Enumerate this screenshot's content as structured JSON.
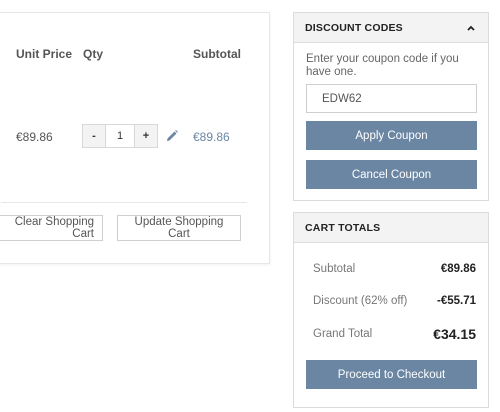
{
  "cart": {
    "headers": {
      "unit_price": "Unit Price",
      "qty": "Qty",
      "subtotal": "Subtotal"
    },
    "item": {
      "unit_price": "€89.86",
      "qty": "1",
      "subtotal": "€89.86"
    },
    "qty_minus": "-",
    "qty_plus": "+",
    "clear_button": "Clear Shopping Cart",
    "update_button": "Update Shopping Cart"
  },
  "discount": {
    "title": "DISCOUNT CODES",
    "description": "Enter your coupon code if you have one.",
    "coupon_value": "EDW62",
    "apply_button": "Apply Coupon",
    "cancel_button": "Cancel Coupon"
  },
  "totals": {
    "title": "CART TOTALS",
    "rows": [
      {
        "label": "Subtotal",
        "value": "€89.86"
      },
      {
        "label": "Discount (62% off)",
        "value": "-€55.71"
      },
      {
        "label": "Grand Total",
        "value": "€34.15"
      }
    ],
    "checkout_button": "Proceed to Checkout"
  },
  "colors": {
    "accent": "#6a86a3",
    "link": "#6b87a4"
  },
  "icons": {
    "edit": "pencil-icon",
    "collapse": "chevron-up-icon"
  }
}
